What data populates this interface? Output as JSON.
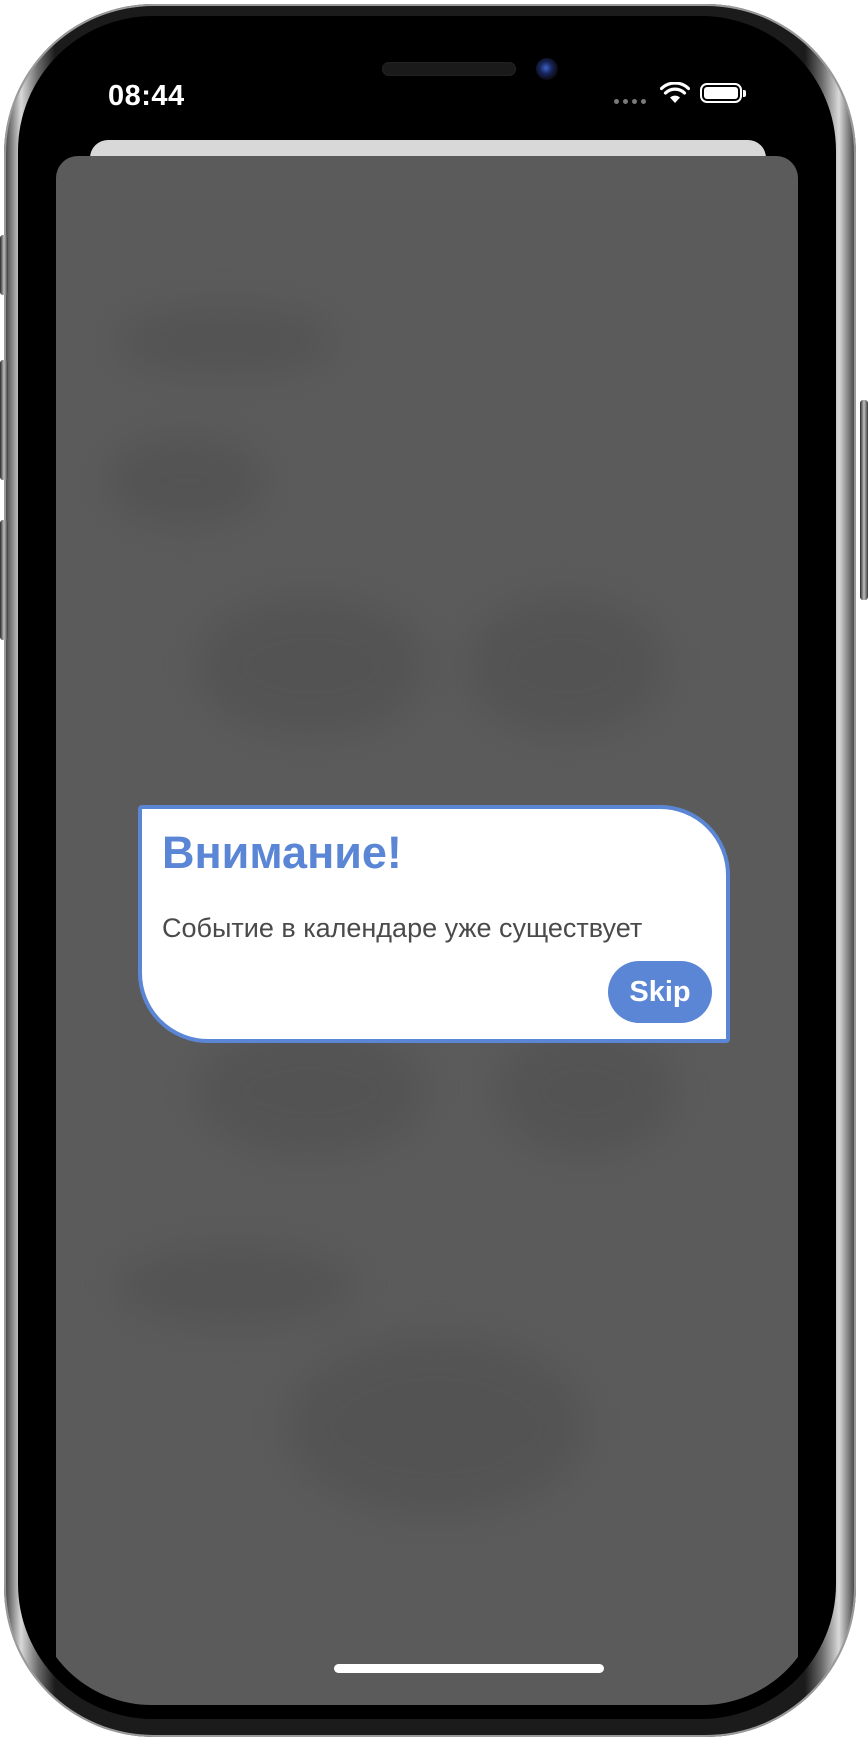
{
  "status_bar": {
    "time": "08:44",
    "wifi_icon": "wifi-icon",
    "battery_icon": "battery-icon",
    "signal_icon": "signal-dots-icon"
  },
  "alert": {
    "title": "Внимание!",
    "message": "Событие в календаре уже существует",
    "skip_label": "Skip"
  },
  "colors": {
    "accent": "#5b86d6",
    "overlay": "#5b5b5b",
    "alert_background": "#ffffff",
    "message_text": "#4a4a4a"
  }
}
